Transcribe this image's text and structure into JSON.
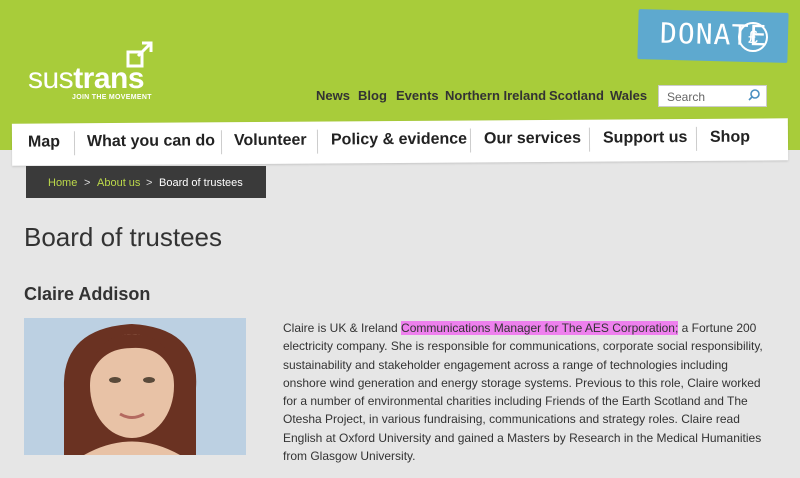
{
  "logo": {
    "light": "sus",
    "bold": "trans",
    "tagline": "JOIN THE MOVEMENT"
  },
  "donate": {
    "label": "DONATE",
    "icon": "pound-coin-icon"
  },
  "topnav": [
    "News",
    "Blog",
    "Events",
    "Northern Ireland",
    "Scotland",
    "Wales"
  ],
  "search": {
    "placeholder": "Search"
  },
  "mainnav": [
    "Map",
    "What you can do",
    "Volunteer",
    "Policy & evidence",
    "Our services",
    "Support us",
    "Shop"
  ],
  "breadcrumb": {
    "home": "Home",
    "sep": ">",
    "about": "About us",
    "current": "Board of trustees"
  },
  "page": {
    "title": "Board of trustees",
    "person": "Claire Addison",
    "bio_pre": "Claire is UK & Ireland ",
    "bio_highlight": "Communications Manager for The AES Corporation;",
    "bio_post": " a Fortune 200 electricity company. She is responsible for communications, corporate social responsibility, sustainability and stakeholder engagement across a range of technologies including onshore wind generation and energy storage systems. Previous to this role, Claire worked for a number of environmental charities including Friends of the Earth Scotland and The Otesha Project, in various fundraising, communications and strategy roles. Claire read English at Oxford University and gained a Masters by Research in the Medical Humanities from Glasgow University."
  },
  "colors": {
    "header": "#a8cc3a",
    "donate": "#5ea9cf",
    "breadcrumb_bg": "#3a3a3a",
    "link": "#bcd94a",
    "highlight": "#ee80ee"
  }
}
